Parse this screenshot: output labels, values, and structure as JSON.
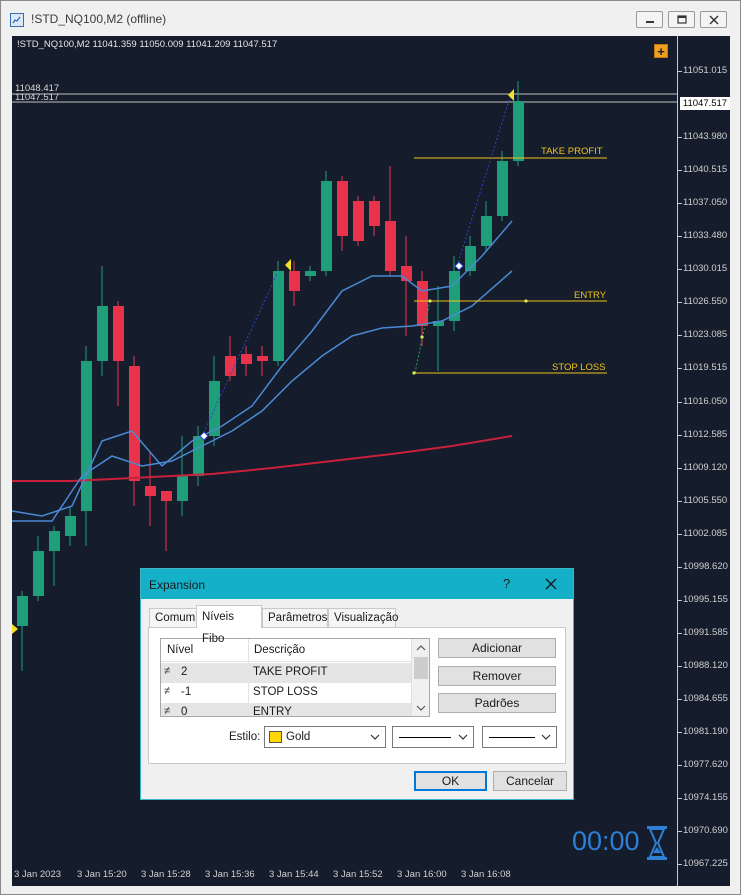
{
  "window": {
    "title": "!STD_NQ100,M2 (offline)"
  },
  "chart": {
    "header": "!STD_NQ100,M2  11041.359 11050.009 11041.209 11047.517",
    "current_price": "11047.517",
    "hline_labels": [
      "11048.417",
      "11047.517"
    ],
    "price_axis": [
      "11051.015",
      "11047.517",
      "11043.980",
      "11040.515",
      "11037.050",
      "11033.480",
      "11030.015",
      "11026.550",
      "11023.085",
      "11019.515",
      "11016.050",
      "11012.585",
      "11009.120",
      "11005.550",
      "11002.085",
      "10998.620",
      "10995.155",
      "10991.585",
      "10988.120",
      "10984.655",
      "10981.190",
      "10977.620",
      "10974.155",
      "10970.690",
      "10967.225"
    ],
    "time_axis": [
      "3 Jan 2023",
      "3 Jan 15:20",
      "3 Jan 15:28",
      "3 Jan 15:36",
      "3 Jan 15:44",
      "3 Jan 15:52",
      "3 Jan 16:00",
      "3 Jan 16:08"
    ],
    "fibo_labels": {
      "take_profit": "TAKE PROFIT",
      "entry": "ENTRY",
      "stop_loss": "STOP LOSS"
    },
    "timer": "00:00",
    "colors": {
      "background": "#151c2b",
      "bull": "#1f9e7a",
      "bear": "#e8334a",
      "ma_slow": "#c8213a",
      "ma_fast": "#4a8ad4",
      "fibo": "#f0c419"
    }
  },
  "dialog": {
    "title": "Expansion",
    "help": "?",
    "tabs": [
      "Comum",
      "Níveis Fibo",
      "Parâmetros",
      "Visualização"
    ],
    "active_tab": "Níveis Fibo",
    "columns": [
      "Nível",
      "Descrição"
    ],
    "rows": [
      {
        "level": "2",
        "desc": "TAKE PROFIT"
      },
      {
        "level": "-1",
        "desc": "STOP LOSS"
      },
      {
        "level": "0",
        "desc": "ENTRY"
      }
    ],
    "buttons": {
      "add": "Adicionar",
      "remove": "Remover",
      "defaults": "Padrões",
      "ok": "OK",
      "cancel": "Cancelar"
    },
    "style_label": "Estilo:",
    "color_value": "Gold",
    "color_swatch": "#ffd700"
  }
}
